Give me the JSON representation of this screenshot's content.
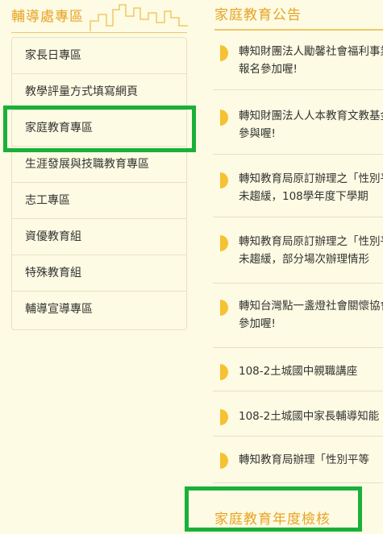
{
  "sidebar": {
    "title": "輔導處專區",
    "items": [
      {
        "label": "家長日專區"
      },
      {
        "label": "教學評量方式填寫網頁"
      },
      {
        "label": "家庭教育專區"
      },
      {
        "label": "生涯發展與技職教育專區"
      },
      {
        "label": "志工專區"
      },
      {
        "label": "資優教育組"
      },
      {
        "label": "特殊教育組"
      },
      {
        "label": "輔導宣導專區"
      }
    ]
  },
  "news": {
    "title": "家庭教育公告",
    "items": [
      {
        "line1": "轉知財團法人勵馨社會福利事業基金會",
        "line2": "報名參加喔!"
      },
      {
        "line1": "轉知財團法人人本教育文教基金會",
        "line2": "參與喔!"
      },
      {
        "line1": "轉知教育局原訂辦理之「性別平等教育」",
        "line2": "未趨緩，108學年度下學期"
      },
      {
        "line1": "轉知教育局原訂辦理之「性別平等教育」",
        "line2": "未趨緩，部分場次辦理情形"
      },
      {
        "line1": "轉知台灣點一盞燈社會關懷協會",
        "line2": "參加喔!"
      },
      {
        "line1": "108-2土城國中親職講座",
        "line2": ""
      },
      {
        "line1": "108-2土城國中家長輔導知能",
        "line2": ""
      },
      {
        "line1": "轉知教育局辦理「性別平等",
        "line2": ""
      }
    ]
  },
  "section2": {
    "title": "家庭教育年度檢核"
  },
  "colors": {
    "accent": "#e8a224",
    "icon": "#f6c132",
    "highlight": "#1ab03a",
    "background": "#fdfbe3"
  }
}
